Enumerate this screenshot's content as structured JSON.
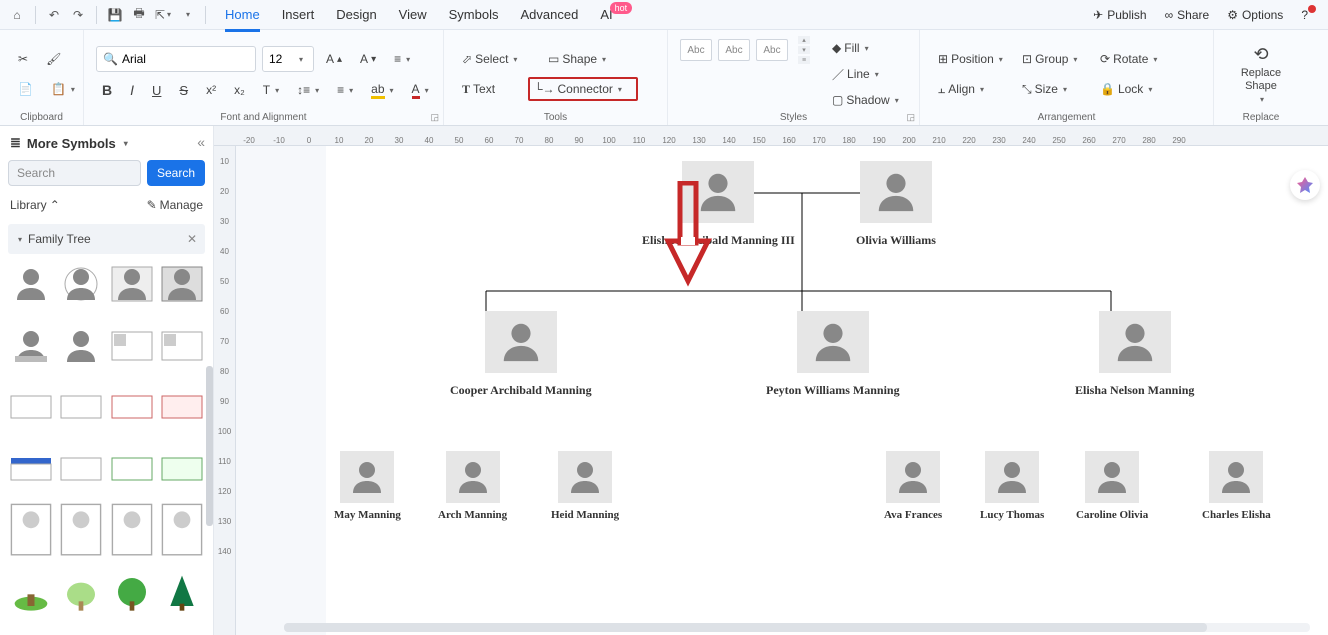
{
  "topbar": {
    "tabs": [
      "Home",
      "Insert",
      "Design",
      "View",
      "Symbols",
      "Advanced",
      "AI"
    ],
    "ai_badge": "hot",
    "active_tab": 0,
    "right": {
      "publish": "Publish",
      "share": "Share",
      "options": "Options"
    }
  },
  "ribbon": {
    "clipboard": {
      "label": "Clipboard"
    },
    "font": {
      "label": "Font and Alignment",
      "family": "Arial",
      "size": "12"
    },
    "tools": {
      "label": "Tools",
      "select": "Select",
      "shape": "Shape",
      "text": "Text",
      "connector": "Connector"
    },
    "styles": {
      "label": "Styles",
      "chips": [
        "Abc",
        "Abc",
        "Abc"
      ],
      "fill": "Fill",
      "line": "Line",
      "shadow": "Shadow"
    },
    "arrangement": {
      "label": "Arrangement",
      "position": "Position",
      "align": "Align",
      "group": "Group",
      "size": "Size",
      "rotate": "Rotate",
      "lock": "Lock"
    },
    "replace": {
      "label": "Replace",
      "btn": "Replace Shape"
    }
  },
  "sidebar": {
    "title": "More Symbols",
    "search_placeholder": "Search",
    "search_btn": "Search",
    "library": "Library",
    "manage": "Manage",
    "category": "Family Tree"
  },
  "ruler_h": [
    "-20",
    "-10",
    "0",
    "10",
    "20",
    "30",
    "40",
    "50",
    "60",
    "70",
    "80",
    "90",
    "100",
    "110",
    "120",
    "130",
    "140",
    "150",
    "160",
    "170",
    "180",
    "190",
    "200",
    "210",
    "220",
    "230",
    "240",
    "250",
    "260",
    "270",
    "280",
    "290"
  ],
  "ruler_v": [
    "10",
    "20",
    "30",
    "40",
    "50",
    "60",
    "70",
    "80",
    "90",
    "100",
    "110",
    "120",
    "130",
    "140"
  ],
  "tree": {
    "gen1": [
      {
        "name": "Elisha Archibald Manning III"
      },
      {
        "name": "Olivia Williams"
      }
    ],
    "gen2": [
      {
        "name": "Cooper Archibald Manning"
      },
      {
        "name": "Peyton Williams Manning"
      },
      {
        "name": "Elisha Nelson Manning"
      }
    ],
    "gen3": [
      {
        "name": "May Manning"
      },
      {
        "name": "Arch Manning"
      },
      {
        "name": "Heid Manning"
      },
      {
        "name": "Ava Frances"
      },
      {
        "name": "Lucy Thomas"
      },
      {
        "name": "Caroline Olivia"
      },
      {
        "name": "Charles Elisha"
      }
    ]
  }
}
